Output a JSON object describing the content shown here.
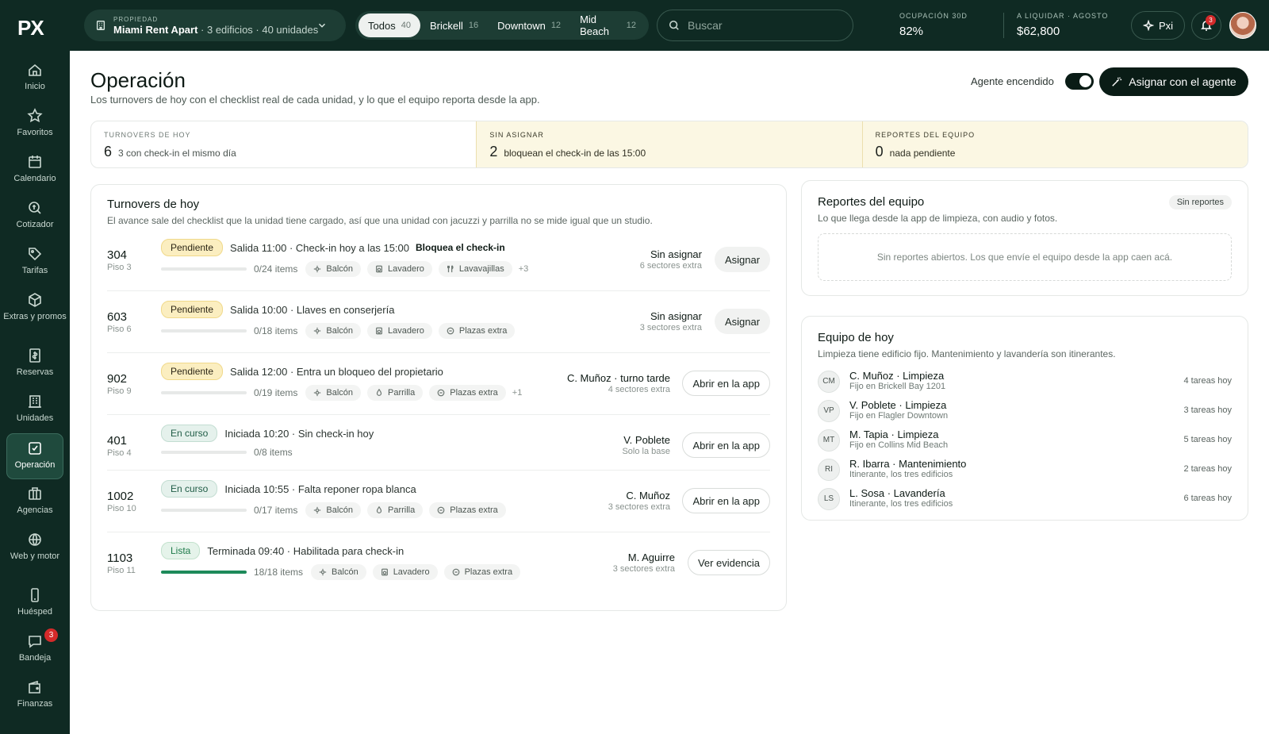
{
  "brand": {
    "logo": "PX"
  },
  "sidebar": {
    "items": [
      {
        "label": "Inicio",
        "icon": "home-icon"
      },
      {
        "label": "Favoritos",
        "icon": "star-icon"
      },
      {
        "label": "Calendario",
        "icon": "calendar-icon"
      },
      {
        "label": "Cotizador",
        "icon": "search-price-icon"
      },
      {
        "label": "Tarifas",
        "icon": "tag-icon"
      },
      {
        "label": "Extras y promos",
        "icon": "box-icon"
      },
      {
        "label": "Reservas",
        "icon": "receipt-icon"
      },
      {
        "label": "Unidades",
        "icon": "building-icon"
      },
      {
        "label": "Operación",
        "icon": "checklist-icon"
      },
      {
        "label": "Agencias",
        "icon": "briefcase-icon"
      },
      {
        "label": "Web y motor",
        "icon": "globe-icon"
      },
      {
        "label": "Huésped",
        "icon": "phone-icon"
      },
      {
        "label": "Bandeja",
        "icon": "chat-icon",
        "badge": "3"
      },
      {
        "label": "Finanzas",
        "icon": "wallet-icon"
      }
    ]
  },
  "header": {
    "property_label": "PROPIEDAD",
    "property_name": "Miami Rent Apart",
    "property_detail": "· 3 edificios · 40 unidades",
    "segments": [
      {
        "label": "Todos",
        "count": "40"
      },
      {
        "label": "Brickell",
        "count": "16"
      },
      {
        "label": "Downtown",
        "count": "12"
      },
      {
        "label": "Mid Beach",
        "count": "12"
      }
    ],
    "search_placeholder": "Buscar",
    "stats": [
      {
        "label": "OCUPACIÓN 30D",
        "value": "82%"
      },
      {
        "label": "A LIQUIDAR · AGOSTO",
        "value": "$62,800"
      }
    ],
    "pxi_label": "Pxi",
    "notif_count": "3"
  },
  "page": {
    "title": "Operación",
    "subtitle": "Los turnovers de hoy con el checklist real de cada unidad, y lo que el equipo reporta desde la app.",
    "agent_label": "Agente encendido",
    "agent_button": "Asignar con el agente"
  },
  "kpis": [
    {
      "label": "TURNOVERS DE HOY",
      "value": "6",
      "desc": "3 con check-in el mismo día"
    },
    {
      "label": "SIN ASIGNAR",
      "value": "2",
      "desc": "bloquean el check-in de las 15:00"
    },
    {
      "label": "REPORTES DEL EQUIPO",
      "value": "0",
      "desc": "nada pendiente"
    }
  ],
  "turnovers": {
    "title": "Turnovers de hoy",
    "subtitle": "El avance sale del checklist que la unidad tiene cargado, así que una unidad con jacuzzi y parrilla no se mide igual que un studio.",
    "rows": [
      {
        "unit": "304",
        "floor": "Piso 3",
        "status": "Pendiente",
        "text": "Salida 11:00 · Check-in hoy a las 15:00",
        "block": "Bloquea el check-in",
        "progress": 0,
        "items": "0/24 items",
        "chips": [
          "Balcón",
          "Lavadero",
          "Lavavajillas"
        ],
        "more": "+3",
        "who": "Sin asignar",
        "extra": "6 sectores extra",
        "action": "Asignar"
      },
      {
        "unit": "603",
        "floor": "Piso 6",
        "status": "Pendiente",
        "text": "Salida 10:00 · Llaves en conserjería",
        "block": "",
        "progress": 0,
        "items": "0/18 items",
        "chips": [
          "Balcón",
          "Lavadero",
          "Plazas extra"
        ],
        "more": "",
        "who": "Sin asignar",
        "extra": "3 sectores extra",
        "action": "Asignar"
      },
      {
        "unit": "902",
        "floor": "Piso 9",
        "status": "Pendiente",
        "text": "Salida 12:00 · Entra un bloqueo del propietario",
        "block": "",
        "progress": 0,
        "items": "0/19 items",
        "chips": [
          "Balcón",
          "Parrilla",
          "Plazas extra"
        ],
        "more": "+1",
        "who": "C. Muñoz · turno tarde",
        "extra": "4 sectores extra",
        "action": "Abrir en la app"
      },
      {
        "unit": "401",
        "floor": "Piso 4",
        "status": "En curso",
        "text": "Iniciada 10:20 · Sin check-in hoy",
        "block": "",
        "progress": 0,
        "items": "0/8 items",
        "chips": [],
        "more": "",
        "who": "V. Poblete",
        "extra": "Solo la base",
        "action": "Abrir en la app"
      },
      {
        "unit": "1002",
        "floor": "Piso 10",
        "status": "En curso",
        "text": "Iniciada 10:55 · Falta reponer ropa blanca",
        "block": "",
        "progress": 0,
        "items": "0/17 items",
        "chips": [
          "Balcón",
          "Parrilla",
          "Plazas extra"
        ],
        "more": "",
        "who": "C. Muñoz",
        "extra": "3 sectores extra",
        "action": "Abrir en la app"
      },
      {
        "unit": "1103",
        "floor": "Piso 11",
        "status": "Lista",
        "text": "Terminada 09:40 · Habilitada para check-in",
        "block": "",
        "progress": 1,
        "items": "18/18 items",
        "chips": [
          "Balcón",
          "Lavadero",
          "Plazas extra"
        ],
        "more": "",
        "who": "M. Aguirre",
        "extra": "3 sectores extra",
        "action": "Ver evidencia"
      }
    ]
  },
  "reports": {
    "title": "Reportes del equipo",
    "subtitle": "Lo que llega desde la app de limpieza, con audio y fotos.",
    "badge": "Sin reportes",
    "empty": "Sin reportes abiertos. Los que envíe el equipo desde la app caen acá."
  },
  "team": {
    "title": "Equipo de hoy",
    "subtitle": "Limpieza tiene edificio fijo. Mantenimiento y lavandería son itinerantes.",
    "members": [
      {
        "initials": "CM",
        "name": "C. Muñoz · Limpieza",
        "role": "Fijo en Brickell Bay 1201",
        "tasks": "4 tareas hoy"
      },
      {
        "initials": "VP",
        "name": "V. Poblete · Limpieza",
        "role": "Fijo en Flagler Downtown",
        "tasks": "3 tareas hoy"
      },
      {
        "initials": "MT",
        "name": "M. Tapia · Limpieza",
        "role": "Fijo en Collins Mid Beach",
        "tasks": "5 tareas hoy"
      },
      {
        "initials": "RI",
        "name": "R. Ibarra · Mantenimiento",
        "role": "Itinerante, los tres edificios",
        "tasks": "2 tareas hoy"
      },
      {
        "initials": "LS",
        "name": "L. Sosa · Lavandería",
        "role": "Itinerante, los tres edificios",
        "tasks": "6 tareas hoy"
      }
    ]
  }
}
